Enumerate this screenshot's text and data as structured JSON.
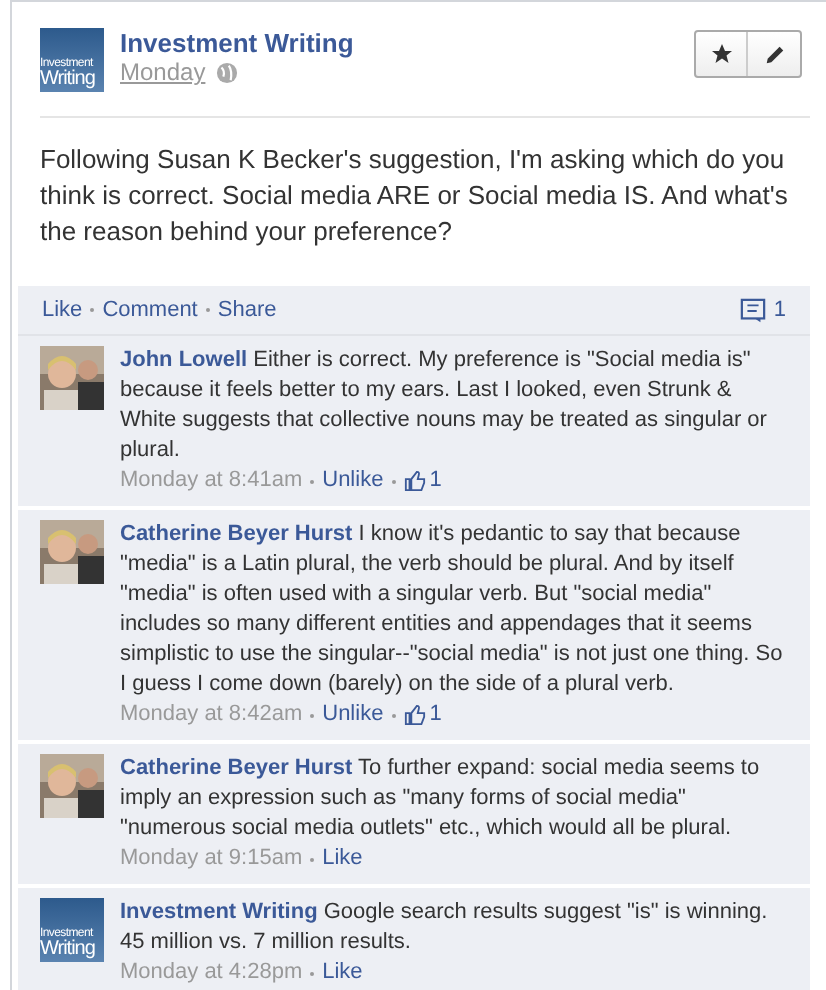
{
  "post": {
    "author": "Investment Writing",
    "logo": {
      "line_1": "Investment",
      "line_2": "Writing"
    },
    "time": "Monday",
    "text": "Following Susan K Becker's suggestion, I'm asking which do you think is correct. Social media ARE or Social media IS. And what's the reason behind your preference?"
  },
  "actions": [
    "Like",
    "Comment",
    "Share"
  ],
  "comment_count": "1",
  "comments": [
    {
      "author": "John Lowell",
      "text": "Either is correct. My preference is \"Social media is\" because it feels better to my ears. Last I looked, even Strunk & White suggests that collective nouns may be treated as singular or plural.",
      "time": "Monday at 8:41am",
      "action": "Unlike",
      "likes": "1"
    },
    {
      "author": "Catherine Beyer Hurst",
      "text": "I know it's pedantic to say that because \"media\" is a Latin plural, the verb should be plural. And by itself \"media\" is often used with a singular verb. But \"social media\" includes so many different entities and appendages that it seems simplistic to use the singular--\"social media\" is not just one thing. So I guess I come down (barely) on the side of a plural verb.",
      "time": "Monday at 8:42am",
      "action": "Unlike",
      "likes": "1"
    },
    {
      "author": "Catherine Beyer Hurst",
      "text": "To further expand: social media seems to imply an expression such as \"many forms of social media\" \"numerous social media outlets\" etc., which would all be plural.",
      "time": "Monday at 9:15am",
      "action": "Like"
    },
    {
      "kind": "logo",
      "logo": {
        "line_1": "Investment",
        "line_2": "Writing"
      },
      "author": "Investment Writing",
      "text": "Google search results suggest \"is\" is winning. 45 million vs. 7 million results.",
      "time": "Monday at 4:28pm",
      "action": "Like"
    }
  ]
}
